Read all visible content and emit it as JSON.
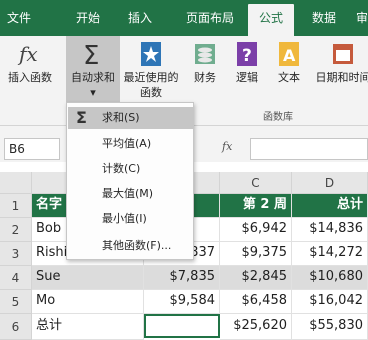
{
  "tabs": [
    "文件",
    "开始",
    "插入",
    "页面布局",
    "公式",
    "数据",
    "审"
  ],
  "active_tab": "公式",
  "ribbon": {
    "insert_function": "插入函数",
    "autosum": "自动求和",
    "recent_line1": "最近使用的",
    "recent_line2": "函数",
    "financial": "财务",
    "logical": "逻辑",
    "text": "文本",
    "datetime": "日期和时间",
    "group_label": "函数库"
  },
  "formula_bar": {
    "name_box": "B6",
    "fx": "fx",
    "value": ""
  },
  "menu": {
    "items": [
      "求和(S)",
      "平均值(A)",
      "计数(C)",
      "最大值(M)",
      "最小值(I)",
      "其他函数(F)..."
    ],
    "highlighted_index": 0
  },
  "sheet": {
    "col_headers": [
      "C",
      "D"
    ],
    "row_headers": [
      "1",
      "2",
      "3",
      "4",
      "5",
      "6"
    ],
    "rows": [
      [
        "名字",
        "",
        "第 2 周",
        "总计"
      ],
      [
        "Bob",
        "",
        "$6,942",
        "$14,836"
      ],
      [
        "Rishi",
        "837",
        "$9,375",
        "$14,272"
      ],
      [
        "Sue",
        "$7,835",
        "$2,845",
        "$10,680"
      ],
      [
        "Mo",
        "$9,584",
        "$6,458",
        "$16,042"
      ],
      [
        "总计",
        "",
        "$25,620",
        "$55,830"
      ]
    ]
  },
  "colors": {
    "accent": "#217346",
    "selected_row_fill": "#dcdcdc"
  }
}
